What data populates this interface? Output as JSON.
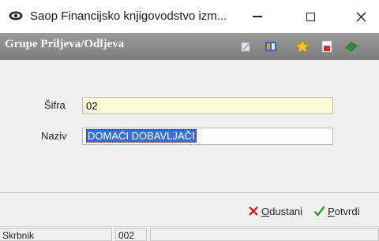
{
  "window": {
    "title": "Saop Financijsko knjigovodstvo izm...",
    "minimize_icon": "minimize-icon",
    "maximize_icon": "maximize-icon",
    "close_icon": "close-icon"
  },
  "header": {
    "title": "Grupe Priljeva/Odljeva",
    "toolbar_icons": [
      "edit-icon",
      "columns-icon",
      "star-icon",
      "document-icon",
      "book-icon"
    ]
  },
  "form": {
    "sifra_label": "Šifra",
    "sifra_value": "02",
    "naziv_label": "Naziv",
    "naziv_value": "DOMAĆI DOBAVLJAČI"
  },
  "actions": {
    "cancel_underlined": "O",
    "cancel_rest": "dustani",
    "ok_underlined": "P",
    "ok_rest": "otvrdi"
  },
  "statusbar": {
    "user": "Skrbnik",
    "code": "002",
    "extra": ""
  },
  "colors": {
    "header_bg": "#8a8a8a",
    "sifra_bg": "#fbfbd6",
    "selection": "#3a6ed6",
    "cancel": "#d32020",
    "ok": "#2f9a2f"
  }
}
